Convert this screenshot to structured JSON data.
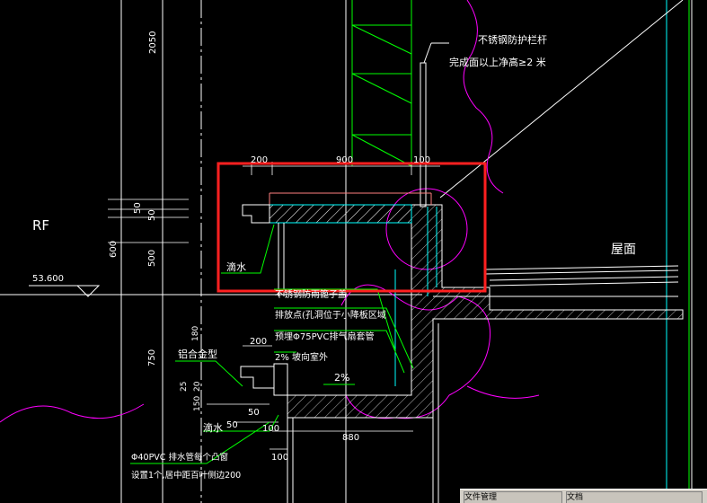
{
  "drawing": {
    "labels": {
      "rf": "RF",
      "elevation": "53.600",
      "roof_surface": "屋面",
      "drip_top": "滴水",
      "drip_bottom": "滴水",
      "aluminum_profile": "铝合金型",
      "railing_line1": "不锈钢防护栏杆",
      "railing_line2": "完成面以上净高≥2 米",
      "gutter_note1": "不锈钢防雨篦子盖",
      "gutter_note2": "排放点(孔洞位于小降板区域",
      "gutter_note3": "预埋Φ75PVC排气扇套管",
      "gutter_note4": "2% 坡向室外",
      "slope": "2%",
      "pvc_note1": "Φ40PVC 排水管每个凸窗",
      "pvc_note2": "设置1个,居中距百叶侧边200"
    },
    "dimensions": {
      "d2050": "2050",
      "d200_top": "200",
      "d900": "900",
      "d100_top": "100",
      "d50_a": "50",
      "d50_b": "50",
      "d600": "600",
      "d500": "500",
      "d750": "750",
      "d200_mid": "200",
      "d180": "180",
      "d25": "25",
      "d20": "20",
      "d150": "150",
      "d50_c": "50",
      "d50_d": "50",
      "d880": "880",
      "d100_bottom": "100",
      "d100_right": "100"
    },
    "colors": {
      "background": "#000000",
      "line_white": "#ffffff",
      "line_green": "#00ff00",
      "line_magenta": "#ff00ff",
      "line_cyan": "#00ffff",
      "highlight_red": "#ff2020",
      "line_yellow": "#ffff00"
    }
  },
  "taskbar": {
    "items": [
      "文件管理",
      "文档"
    ]
  }
}
